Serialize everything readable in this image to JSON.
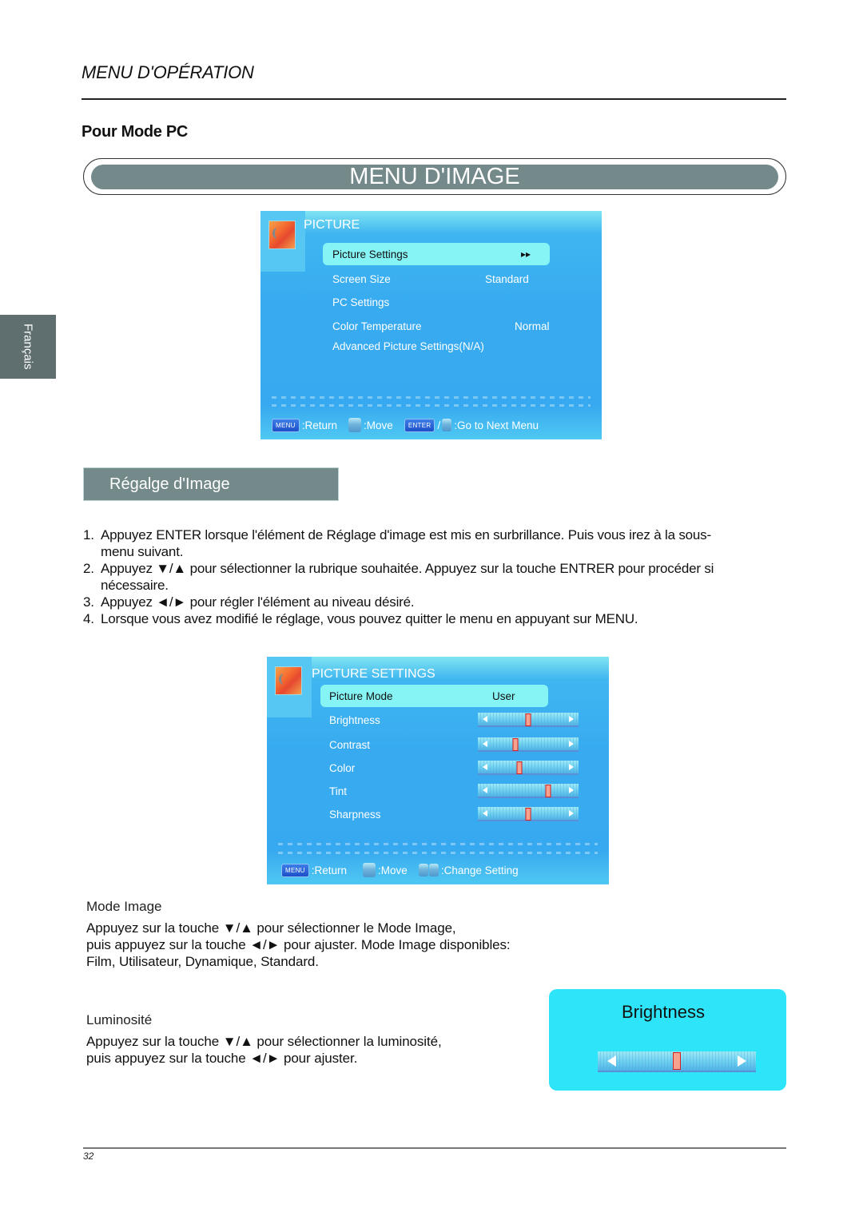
{
  "header": {
    "section_title": "MENU D'OPÉRATION",
    "subtitle": "Pour Mode PC",
    "banner": "MENU D'IMAGE"
  },
  "side_tab": {
    "language": "Français"
  },
  "osd_picture": {
    "title": "PICTURE",
    "items": [
      {
        "label": "Picture Settings",
        "value": "▸▸",
        "selected": true
      },
      {
        "label": "Screen Size",
        "value": "Standard",
        "selected": false
      },
      {
        "label": "PC Settings",
        "value": "",
        "selected": false
      },
      {
        "label": "Color Temperature",
        "value": "Normal",
        "selected": false
      },
      {
        "label": "Advanced Picture Settings(N/A)",
        "value": "",
        "selected": false
      }
    ],
    "footer": {
      "menu_key": "MENU",
      "return_label": ":Return",
      "move_label": ":Move",
      "enter_key": "ENTER",
      "separator": "/",
      "next_label": ":Go to Next Menu"
    }
  },
  "section_bar": {
    "label": "Régalge d'Image"
  },
  "steps": [
    {
      "num": "1.",
      "text": "Appuyez ENTER lorsque l'élément de Réglage d'image est mis en surbrillance. Puis vous irez à la sous-menu suivant."
    },
    {
      "num": "2.",
      "text": "Appuyez ▼/▲ pour sélectionner la rubrique souhaitée. Appuyez sur la touche ENTRER pour procéder si nécessaire."
    },
    {
      "num": "3.",
      "text": "Appuyez ◄/► pour régler l'élément au niveau désiré."
    },
    {
      "num": "4.",
      "text": "Lorsque vous avez modifié le réglage, vous pouvez quitter le menu en appuyant sur MENU."
    }
  ],
  "osd_picture_settings": {
    "title": "PICTURE SETTINGS",
    "mode": {
      "label": "Picture Mode",
      "value": "User"
    },
    "sliders": [
      {
        "label": "Brightness",
        "level_percent": 50
      },
      {
        "label": "Contrast",
        "level_percent": 37
      },
      {
        "label": "Color",
        "level_percent": 41
      },
      {
        "label": "Tint",
        "level_percent": 70
      },
      {
        "label": "Sharpness",
        "level_percent": 50
      }
    ],
    "footer": {
      "menu_key": "MENU",
      "return_label": ":Return",
      "move_label": ":Move",
      "change_label": ":Change Setting"
    }
  },
  "mode_image": {
    "heading": "Mode Image",
    "lines": [
      "Appuyez sur la touche ▼/▲ pour sélectionner le Mode Image,",
      "puis appuyez sur la touche ◄/► pour ajuster. Mode Image disponibles:",
      "Film, Utilisateur, Dynamique, Standard."
    ]
  },
  "luminosite": {
    "heading": "Luminosité",
    "lines": [
      "Appuyez sur la touche ▼/▲ pour sélectionner la luminosité,",
      "puis appuyez sur la touche ◄/► pour ajuster."
    ]
  },
  "brightness_card": {
    "title": "Brightness",
    "level_percent": 50
  },
  "page": {
    "number": "32"
  },
  "colors": {
    "banner_gray": "#73898a",
    "osd_blue": "#38abf0",
    "osd_highlight": "#86f3f4",
    "brightness_card": "#2de4f8",
    "slider_knob": "#f7a28f"
  }
}
